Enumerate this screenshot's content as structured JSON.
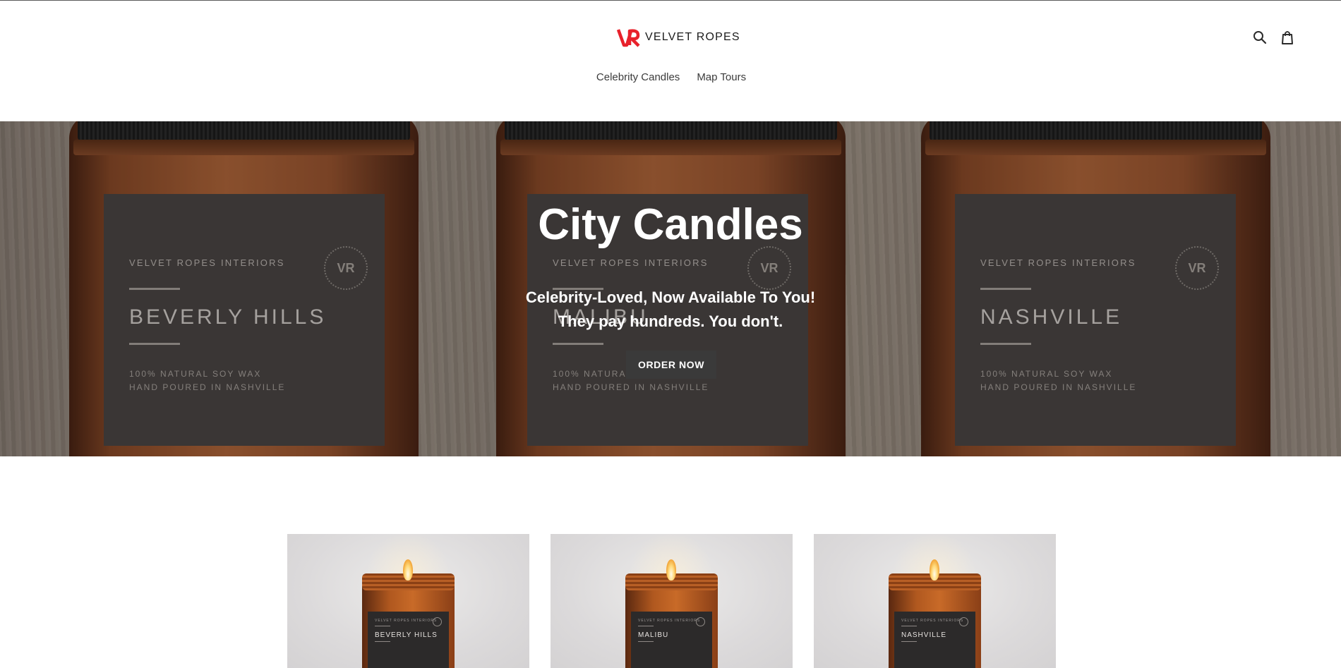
{
  "header": {
    "logo_mark": "VR",
    "logo_text": "VELVET ROPES",
    "nav": [
      {
        "label": "Celebrity Candles"
      },
      {
        "label": "Map Tours"
      }
    ],
    "icons": [
      "search-icon",
      "cart-icon"
    ]
  },
  "hero": {
    "title": "City Candles",
    "subtitle_line1": "Celebrity-Loved, Now Available To You!",
    "subtitle_line2": "They pay hundreds. You don't.",
    "button": "ORDER NOW",
    "jars": [
      {
        "brand": "VELVET ROPES INTERIORS",
        "city": "BEVERLY HILLS",
        "fine1": "100% NATURAL SOY WAX",
        "fine2": "HAND POURED IN NASHVILLE",
        "seal": "VR"
      },
      {
        "brand": "VELVET ROPES INTERIORS",
        "city": "MALIBU",
        "fine1": "100% NATURAL SOY WAX",
        "fine2": "HAND POURED IN NASHVILLE",
        "seal": "VR"
      },
      {
        "brand": "VELVET ROPES INTERIORS",
        "city": "NASHVILLE",
        "fine1": "100% NATURAL SOY WAX",
        "fine2": "HAND POURED IN NASHVILLE",
        "seal": "VR"
      }
    ]
  },
  "products": [
    {
      "brand": "VELVET ROPES INTERIORS",
      "city": "BEVERLY HILLS"
    },
    {
      "brand": "VELVET ROPES INTERIORS",
      "city": "MALIBU"
    },
    {
      "brand": "VELVET ROPES INTERIORS",
      "city": "NASHVILLE"
    }
  ],
  "colors": {
    "brand_red": "#e8212b",
    "button_bg": "#3a3a3a",
    "text": "#3a3a3a"
  }
}
